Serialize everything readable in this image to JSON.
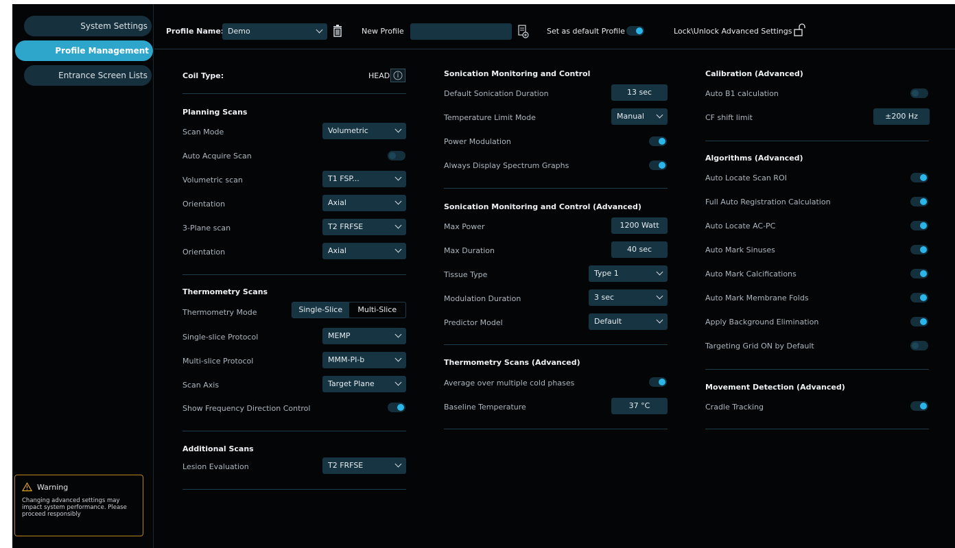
{
  "sidebar": {
    "items": [
      {
        "label": "System Settings",
        "active": false
      },
      {
        "label": "Profile Management",
        "active": true
      },
      {
        "label": "Entrance Screen Lists",
        "active": false
      }
    ],
    "warning": {
      "title": "Warning",
      "text": "Changing advanced settings may impact system performance. Please proceed responsibly"
    }
  },
  "header": {
    "profile_name_label": "Profile Name:",
    "profile_name_value": "Demo",
    "new_profile_label": "New Profile",
    "new_profile_value": "",
    "default_label": "Set as default Profile",
    "default_on": true,
    "lock_label": "Lock\\Unlock Advanced Settings"
  },
  "col1": {
    "coil_label": "Coil Type:",
    "coil_value": "HEAD",
    "planning": {
      "title": "Planning Scans",
      "scan_mode_label": "Scan Mode",
      "scan_mode_value": "Volumetric",
      "auto_acquire_label": "Auto Acquire Scan",
      "auto_acquire_on": false,
      "volumetric_label": "Volumetric scan",
      "volumetric_value": "T1 FSP...",
      "orientation1_label": "Orientation",
      "orientation1_value": "Axial",
      "plane3_label": "3-Plane scan",
      "plane3_value": "T2 FRFSE",
      "orientation2_label": "Orientation",
      "orientation2_value": "Axial"
    },
    "thermo": {
      "title": "Thermometry Scans",
      "mode_label": "Thermometry Mode",
      "mode_options": [
        "Single-Slice",
        "Multi-Slice"
      ],
      "mode_selected": "Single-Slice",
      "single_label": "Single-slice Protocol",
      "single_value": "MEMP",
      "multi_label": "Multi-slice Protocol",
      "multi_value": "MMM-PI-b",
      "axis_label": "Scan Axis",
      "axis_value": "Target Plane",
      "freq_label": "Show Frequency Direction Control",
      "freq_on": true
    },
    "additional": {
      "title": "Additional Scans",
      "lesion_label": "Lesion Evaluation",
      "lesion_value": "T2 FRFSE"
    }
  },
  "col2": {
    "sonication": {
      "title": "Sonication Monitoring and Control",
      "duration_label": "Default Sonication Duration",
      "duration_value": "13 sec",
      "temp_mode_label": "Temperature Limit Mode",
      "temp_mode_value": "Manual",
      "power_mod_label": "Power Modulation",
      "power_mod_on": true,
      "spectrum_label": "Always Display Spectrum Graphs",
      "spectrum_on": true
    },
    "sonication_adv": {
      "title": "Sonication Monitoring and Control (Advanced)",
      "max_power_label": "Max Power",
      "max_power_value": "1200 Watt",
      "max_duration_label": "Max Duration",
      "max_duration_value": "40 sec",
      "tissue_label": "Tissue Type",
      "tissue_value": "Type 1",
      "mod_duration_label": "Modulation Duration",
      "mod_duration_value": "3 sec",
      "predictor_label": "Predictor Model",
      "predictor_value": "Default"
    },
    "thermo_adv": {
      "title": "Thermometry Scans (Advanced)",
      "avg_label": "Average over multiple  cold phases",
      "avg_on": true,
      "baseline_label": "Baseline Temperature",
      "baseline_value": "37 °C"
    }
  },
  "col3": {
    "calibration": {
      "title": "Calibration (Advanced)",
      "b1_label": "Auto B1 calculation",
      "b1_on": false,
      "cf_label": "CF shift limit",
      "cf_value": "±200 Hz"
    },
    "algorithms": {
      "title": "Algorithms (Advanced)",
      "items": [
        {
          "label": "Auto Locate Scan ROI",
          "on": true
        },
        {
          "label": "Full Auto Registration Calculation",
          "on": true
        },
        {
          "label": "Auto Locate AC-PC",
          "on": true
        },
        {
          "label": "Auto Mark Sinuses",
          "on": true
        },
        {
          "label": "Auto Mark Calcifications",
          "on": true
        },
        {
          "label": "Auto Mark Membrane Folds",
          "on": true
        },
        {
          "label": "Apply Background Elimination",
          "on": true
        },
        {
          "label": "Targeting Grid ON by Default",
          "on": false
        }
      ]
    },
    "movement": {
      "title": "Movement Detection (Advanced)",
      "cradle_label": "Cradle Tracking",
      "cradle_on": true
    }
  },
  "colors": {
    "accent": "#2ea6cc",
    "field": "#163442",
    "warning_border": "#b8861b",
    "background": "#030507"
  }
}
